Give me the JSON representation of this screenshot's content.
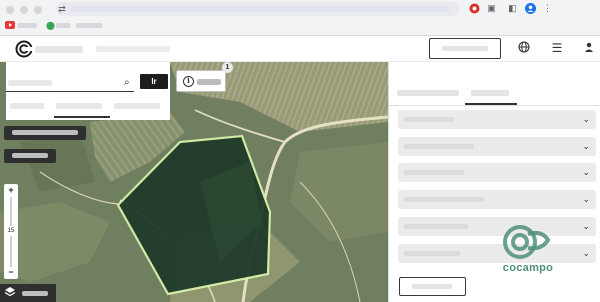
{
  "browser": {
    "omnibox_icon": "tune-icon",
    "extensions": [
      "extension-red-icon",
      "puzzle-icon",
      "sidebar-icon",
      "profile-icon",
      "more-vert-icon"
    ]
  },
  "search": {
    "go_label": "Ir",
    "placeholder": ""
  },
  "map": {
    "info_badge": "1",
    "zoom": {
      "plus": "+",
      "minus": "−",
      "level": "15"
    }
  },
  "watermark": {
    "text": "cocampo"
  },
  "colors": {
    "field_fill": "#1f3b2a",
    "field_stroke": "#d6f0a8",
    "watermark": "#4f8f7a",
    "dark_chip": "#2f2f2f"
  }
}
